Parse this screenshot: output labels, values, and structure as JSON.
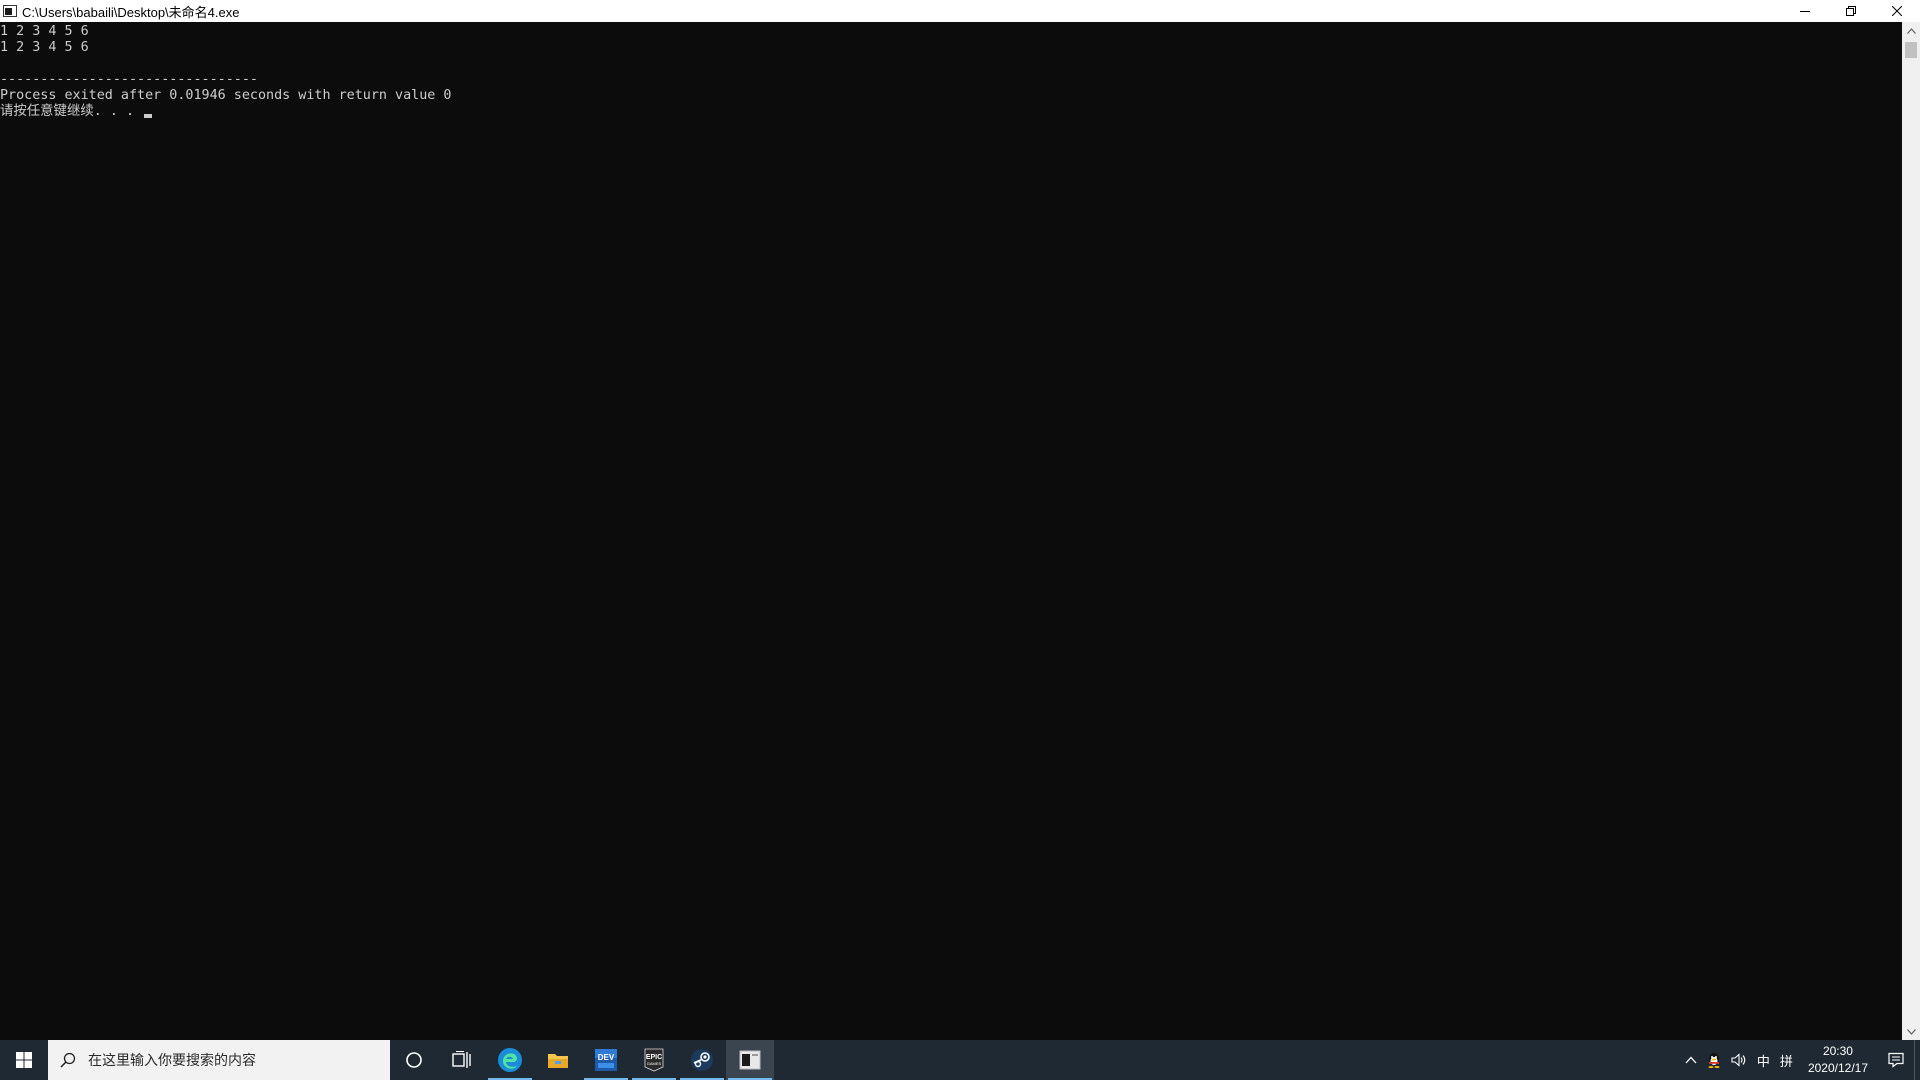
{
  "window": {
    "title": "C:\\Users\\babaili\\Desktop\\未命名4.exe",
    "controls": {
      "minimize": "minimize",
      "restore": "restore",
      "close": "close"
    }
  },
  "console": {
    "lines": [
      "1 2 3 4 5 6",
      "1 2 3 4 5 6",
      "",
      "--------------------------------",
      "Process exited after 0.01946 seconds with return value 0",
      "请按任意键继续. . . "
    ]
  },
  "taskbar": {
    "search_placeholder": "在这里输入你要搜索的内容",
    "apps": [
      {
        "name": "cortana",
        "icon": "circle-icon"
      },
      {
        "name": "task-view",
        "icon": "task-view-icon"
      },
      {
        "name": "edge",
        "icon": "edge-icon"
      },
      {
        "name": "file-explorer",
        "icon": "folder-icon"
      },
      {
        "name": "dev-cpp",
        "icon": "dev-cpp-icon",
        "label": "DEV"
      },
      {
        "name": "epic-games",
        "icon": "epic-games-icon",
        "label": "EPIC"
      },
      {
        "name": "steam",
        "icon": "steam-icon"
      },
      {
        "name": "console",
        "icon": "console-icon"
      }
    ],
    "tray": {
      "ime_lang": "中",
      "ime_mode": "拼",
      "time": "20:30",
      "date": "2020/12/17"
    }
  },
  "colors": {
    "console_bg": "#0c0c0c",
    "console_fg": "#cccccc",
    "taskbar_bg": "#1f2933",
    "accent": "#76b9ed"
  }
}
